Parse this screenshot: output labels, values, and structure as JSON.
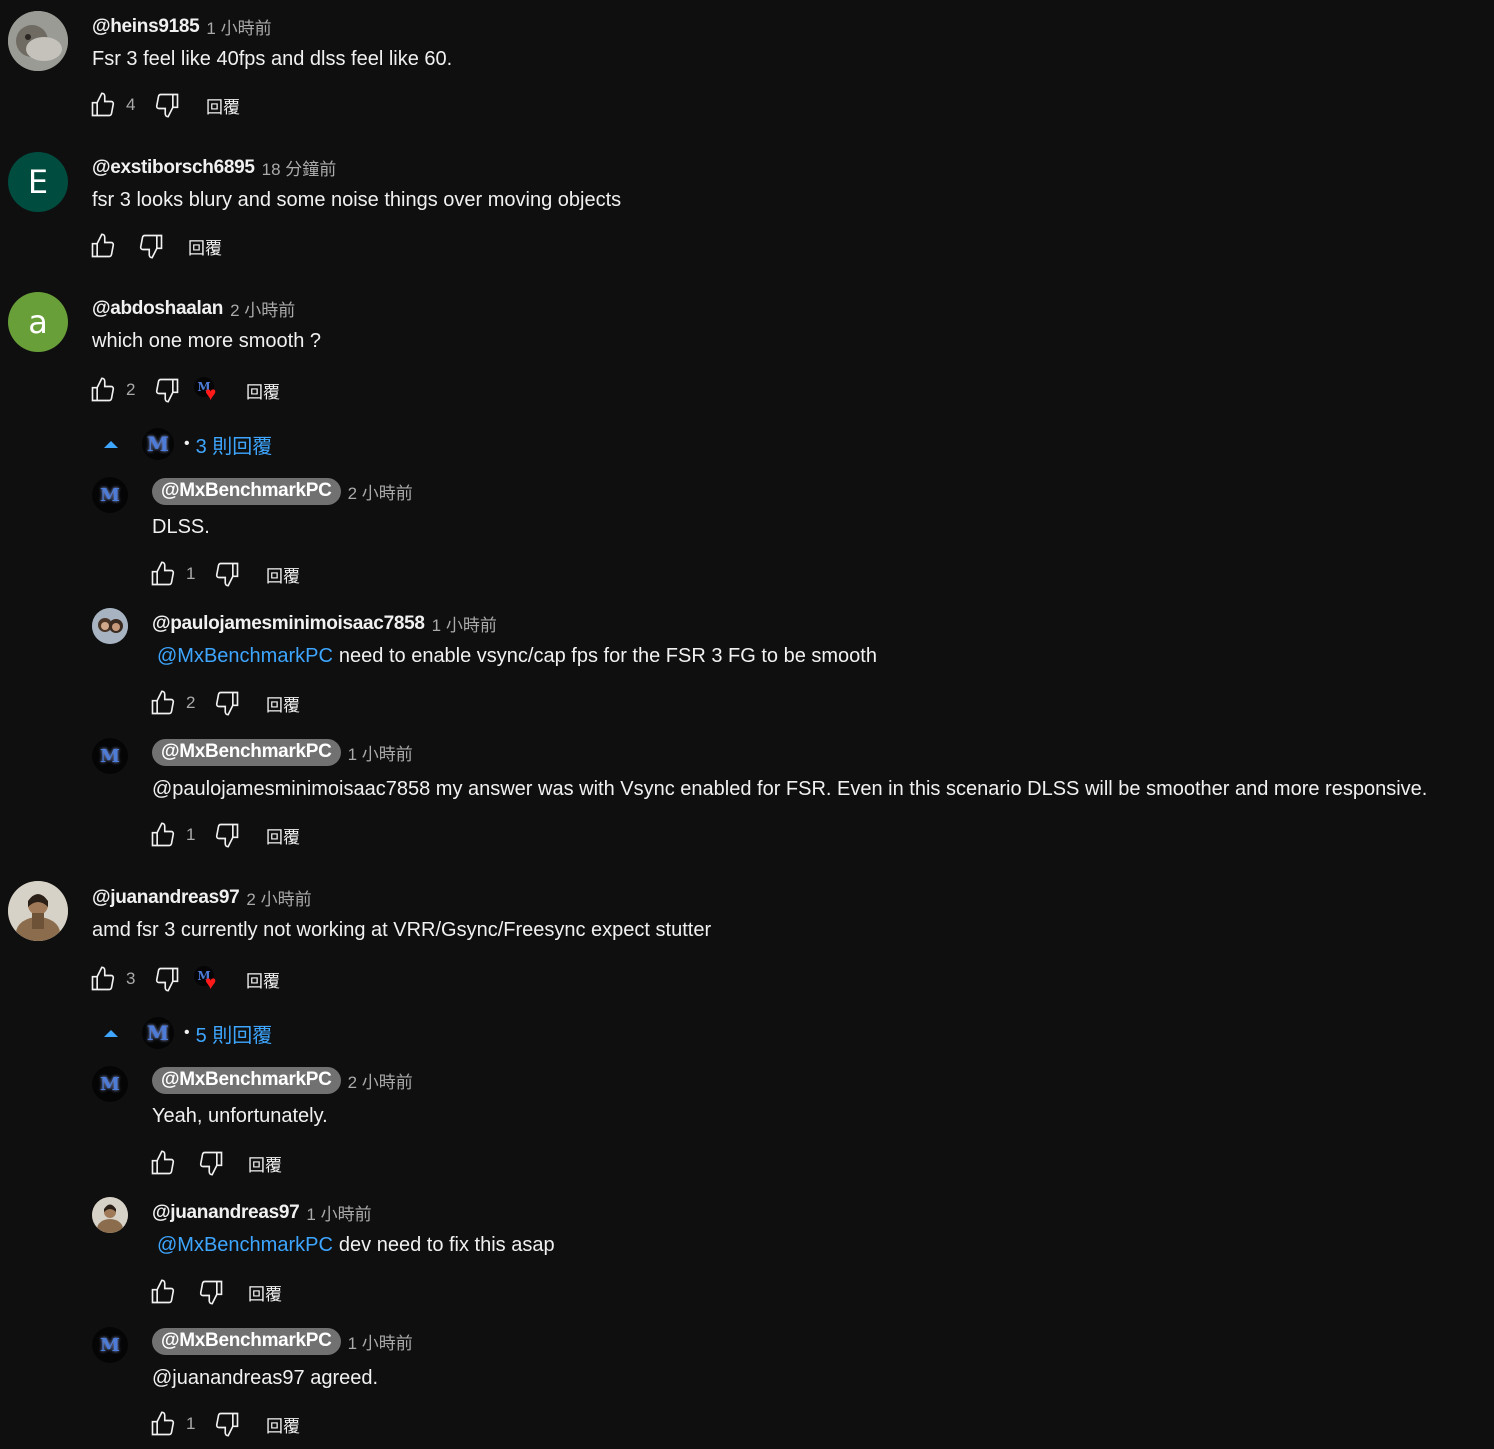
{
  "reply_label": "回覆",
  "comments": [
    {
      "author": "@heins9185",
      "time": "1 小時前",
      "text": "Fsr 3 feel like 40fps and dlss feel like 60.",
      "likes": "4",
      "avatar_letter": "",
      "avatar_color": "#8a8a8a"
    },
    {
      "author": "@exstiborsch6895",
      "time": "18 分鐘前",
      "text": "fsr 3 looks blury and some noise things over moving objects",
      "likes": "",
      "avatar_letter": "E",
      "avatar_color": "#004d40"
    },
    {
      "author": "@abdoshaalan",
      "time": "2 小時前",
      "text": "which one more smooth ?",
      "likes": "2",
      "avatar_letter": "a",
      "avatar_color": "#689f38",
      "hearted": true,
      "replies_toggle": {
        "count_label": "3 則回覆"
      },
      "replies": [
        {
          "author": "@MxBenchmarkPC",
          "creator": true,
          "time": "2 小時前",
          "text": "DLSS.",
          "likes": "1"
        },
        {
          "author": "@paulojamesminimoisaac7858",
          "creator": false,
          "time": "1 小時前",
          "mention": "@MxBenchmarkPC",
          "text": "need to enable vsync/cap fps for the FSR 3 FG to be smooth",
          "likes": "2"
        },
        {
          "author": "@MxBenchmarkPC",
          "creator": true,
          "time": "1 小時前",
          "text": "@paulojamesminimoisaac7858 my answer was with Vsync enabled for FSR. Even in this scenario DLSS will be smoother and more responsive.",
          "likes": "1"
        }
      ]
    },
    {
      "author": "@juanandreas97",
      "time": "2 小時前",
      "text": "amd fsr 3 currently not working at VRR/Gsync/Freesync expect stutter",
      "likes": "3",
      "avatar_letter": "",
      "avatar_color": "#7a6a55",
      "hearted": true,
      "replies_toggle": {
        "count_label": "5 則回覆"
      },
      "replies": [
        {
          "author": "@MxBenchmarkPC",
          "creator": true,
          "time": "2 小時前",
          "text": "Yeah, unfortunately.",
          "likes": ""
        },
        {
          "author": "@juanandreas97",
          "creator": false,
          "time": "1 小時前",
          "mention": "@MxBenchmarkPC",
          "text": "dev need to fix this asap",
          "likes": ""
        },
        {
          "author": "@MxBenchmarkPC",
          "creator": true,
          "time": "1 小時前",
          "text": "@juanandreas97 agreed.",
          "likes": "1"
        }
      ]
    }
  ],
  "creator_avatar_letter": "M",
  "colors": {
    "background": "#0f0f0f",
    "link": "#3ea6ff",
    "muted": "#aaaaaa",
    "heart": "#ff1a1a"
  },
  "icons": {
    "like": "thumbs-up-icon",
    "dislike": "thumbs-down-icon",
    "collapse": "caret-up-icon",
    "heart": "heart-icon"
  }
}
